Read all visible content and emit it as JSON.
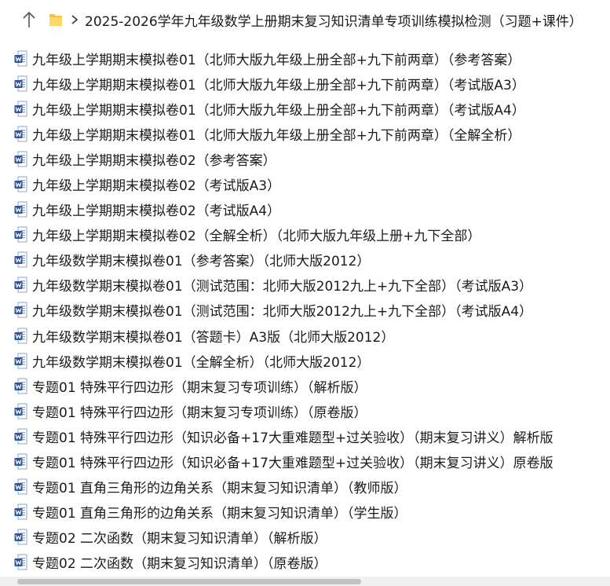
{
  "toolbar": {
    "up_icon": "arrow-up-icon",
    "folder_icon": "folder-icon",
    "separator_icon": "chevron-right-icon"
  },
  "breadcrumb": {
    "path": "2025-2026学年九年级数学上册期末复习知识清单专项训练模拟检测（习题+课件）"
  },
  "files": [
    {
      "name": "九年级上学期期末模拟卷01（北师大版九年级上册全部+九下前两章）（参考答案）",
      "icon": "word-doc-icon"
    },
    {
      "name": "九年级上学期期末模拟卷01（北师大版九年级上册全部+九下前两章）（考试版A3）",
      "icon": "word-doc-icon"
    },
    {
      "name": "九年级上学期期末模拟卷01（北师大版九年级上册全部+九下前两章）（考试版A4）",
      "icon": "word-doc-icon"
    },
    {
      "name": "九年级上学期期末模拟卷01（北师大版九年级上册全部+九下前两章）（全解全析）",
      "icon": "word-doc-icon"
    },
    {
      "name": "九年级上学期期末模拟卷02（参考答案）",
      "icon": "word-doc-icon"
    },
    {
      "name": "九年级上学期期末模拟卷02（考试版A3）",
      "icon": "word-doc-icon"
    },
    {
      "name": "九年级上学期期末模拟卷02（考试版A4）",
      "icon": "word-doc-icon"
    },
    {
      "name": "九年级上学期期末模拟卷02（全解全析）（北师大版九年级上册+九下全部）",
      "icon": "word-doc-icon"
    },
    {
      "name": "九年级数学期末模拟卷01（参考答案）（北师大版2012）",
      "icon": "word-doc-icon"
    },
    {
      "name": "九年级数学期末模拟卷01（测试范围：北师大版2012九上+九下全部）（考试版A3）",
      "icon": "word-doc-icon"
    },
    {
      "name": "九年级数学期末模拟卷01（测试范围：北师大版2012九上+九下全部）（考试版A4）",
      "icon": "word-doc-icon"
    },
    {
      "name": "九年级数学期末模拟卷01（答题卡）A3版（北师大版2012）",
      "icon": "word-doc-icon"
    },
    {
      "name": "九年级数学期末模拟卷01（全解全析）（北师大版2012）",
      "icon": "word-doc-icon"
    },
    {
      "name": "专题01 特殊平行四边形（期末复习专项训练）（解析版）",
      "icon": "word-doc-icon"
    },
    {
      "name": "专题01 特殊平行四边形（期末复习专项训练）（原卷版）",
      "icon": "word-doc-icon"
    },
    {
      "name": "专题01 特殊平行四边形（知识必备+17大重难题型+过关验收）（期末复习讲义）解析版",
      "icon": "word-doc-icon"
    },
    {
      "name": "专题01 特殊平行四边形（知识必备+17大重难题型+过关验收）（期末复习讲义）原卷版",
      "icon": "word-doc-icon"
    },
    {
      "name": "专题01 直角三角形的边角关系（期末复习知识清单）（教师版）",
      "icon": "word-doc-icon"
    },
    {
      "name": "专题01 直角三角形的边角关系（期末复习知识清单）（学生版）",
      "icon": "word-doc-icon"
    },
    {
      "name": "专题02  二次函数（期末复习知识清单）（解析版）",
      "icon": "word-doc-icon"
    },
    {
      "name": "专题02  二次函数（期末复习知识清单）（原卷版）",
      "icon": "word-doc-icon"
    }
  ],
  "colors": {
    "word_blue": "#2b579a",
    "word_blue_light": "#41a5ee",
    "folder_yellow": "#f5c04a",
    "text": "#1a1a1a"
  }
}
